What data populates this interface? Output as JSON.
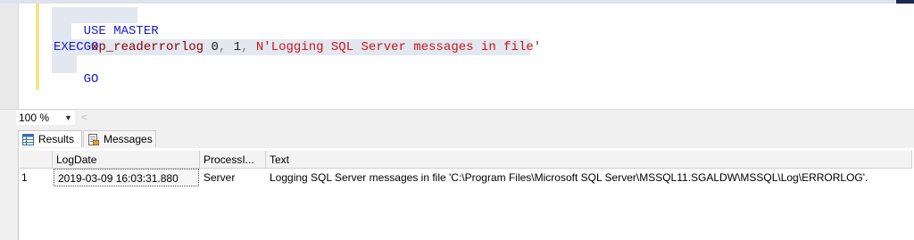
{
  "editor": {
    "line1": {
      "kw": "USE MASTER"
    },
    "line2": {
      "kw": "GO"
    },
    "line3": {
      "kw": "EXEC",
      "fn": "xp_readerrorlog",
      "arg1": "0",
      "comma1": ",",
      "arg2": "1",
      "comma2": ",",
      "str": "N'Logging SQL Server messages in file'"
    },
    "line4": {
      "kw": "GO"
    }
  },
  "zoom": {
    "value": "100 %"
  },
  "tabs": {
    "results": "Results",
    "messages": "Messages"
  },
  "grid": {
    "columns": [
      "LogDate",
      "ProcessI...",
      "Text"
    ],
    "rows": [
      {
        "num": "1",
        "logdate": "2019-03-09 16:03:31.880",
        "process": "Server",
        "text": "Logging SQL Server messages in file 'C:\\Program Files\\Microsoft SQL Server\\MSSQL11.SGALDW\\MSSQL\\Log\\ERRORLOG'."
      }
    ]
  },
  "colors": {
    "keyword": "#1a1acc",
    "function": "#8b0000",
    "string": "#c8171c",
    "selection": "#e3e7ef"
  }
}
